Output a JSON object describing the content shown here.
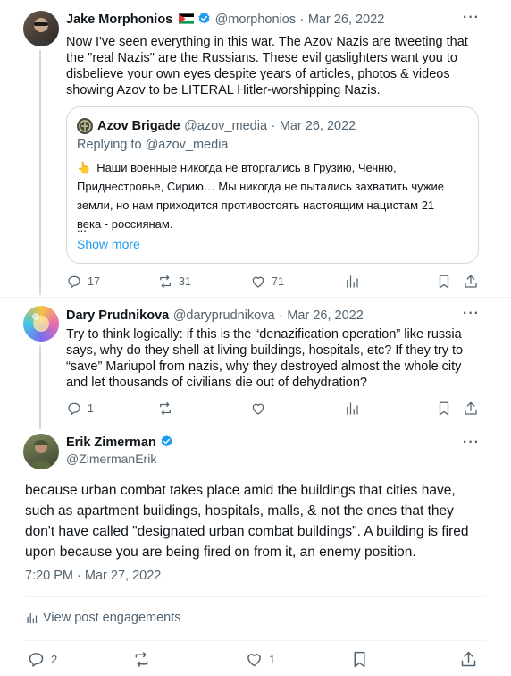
{
  "tweet1": {
    "name": "Jake Morphonios",
    "handle": "@morphonios",
    "sep": "·",
    "date": "Mar 26, 2022",
    "text": "Now I've seen everything in this war. The Azov Nazis are tweeting that the \"real Nazis\" are the Russians. These evil gaslighters want you to disbelieve your own eyes despite years of articles, photos & videos showing Azov to be LITERAL Hitler-worshipping Nazis.",
    "quote": {
      "name": "Azov Brigade",
      "handle": "@azov_media",
      "sep": "·",
      "date": "Mar 26, 2022",
      "replying": "Replying to @azov_media",
      "emoji": "👆",
      "text": "Наши военные никогда не вторгались в Грузию, Чечню, Приднестровье, Сирию… Мы никогда не пытались захватить чужие земли, но нам приходится противостоять настоящим нацистам 21 века - россиянам.",
      "ellipsis": "...",
      "show_more": "Show more"
    },
    "replies": "17",
    "reposts": "31",
    "likes": "71"
  },
  "tweet2": {
    "name": "Dary Prudnikova",
    "handle": "@daryprudnikova",
    "sep": "·",
    "date": "Mar 26, 2022",
    "text": "Try to think logically: if this is the “denazification operation” like russia says, why do they shell at living buildings, hospitals, etc? If they try to “save” Mariupol from nazis, why they destroyed almost the whole city and let thousands of civilians die out of dehydration?",
    "replies": "1"
  },
  "main": {
    "name": "Erik Zimerman",
    "handle": "@ZimermanErik",
    "text": "because urban combat takes place amid the buildings that cities have, such as apartment buildings, hospitals, malls, & not the ones that they don't have called \"designated urban combat buildings\". A building is fired upon because you are being fired on from it, an enemy position.",
    "timestamp": "7:20 PM · Mar 27, 2022",
    "engagements": "View post engagements",
    "replies": "2",
    "likes": "1"
  },
  "colors": {
    "verified": "#1d9bf0",
    "secondary": "#536471",
    "link": "#1d9bf0"
  },
  "icons": [
    "reply-icon",
    "repost-icon",
    "like-icon",
    "views-icon",
    "bookmark-icon",
    "share-icon",
    "more-icon",
    "verified-badge-icon",
    "palestine-flag-icon"
  ]
}
